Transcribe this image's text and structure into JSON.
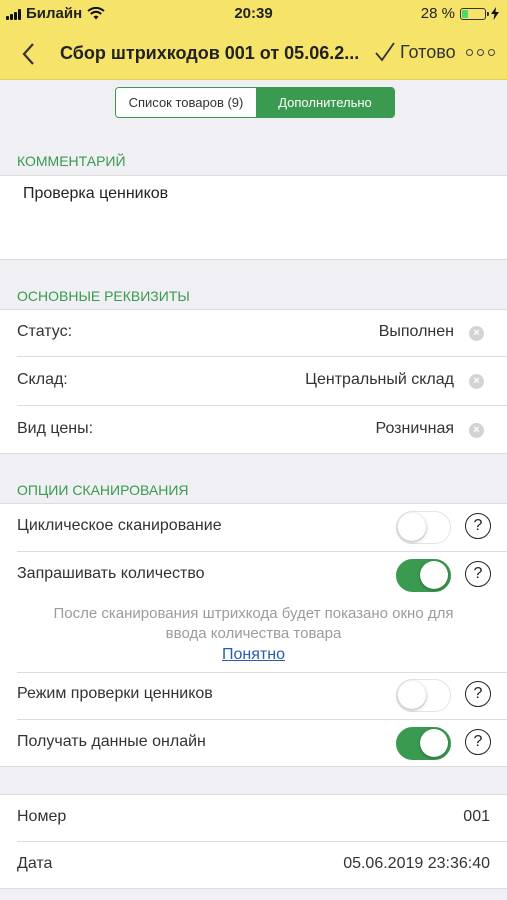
{
  "status_bar": {
    "carrier": "Билайн",
    "time": "20:39",
    "battery": "28 %",
    "battery_level": 0.28
  },
  "nav": {
    "title": "Сбор штрихкодов 001 от 05.06.2...",
    "done_label": "Готово",
    "icons": [
      "back-chevron-icon",
      "checkmark-icon",
      "more-icon"
    ]
  },
  "tabs": [
    {
      "label": "Список товаров (9)",
      "active": false
    },
    {
      "label": "Дополнительно",
      "active": true
    }
  ],
  "comment_section": {
    "header": "КОММЕНТАРИЙ",
    "text": "Проверка ценников"
  },
  "main_section": {
    "header": "ОСНОВНЫЕ РЕКВИЗИТЫ",
    "rows": [
      {
        "label": "Статус:",
        "value": "Выполнен"
      },
      {
        "label": "Склад:",
        "value": "Центральный склад"
      },
      {
        "label": "Вид цены:",
        "value": "Розничная"
      }
    ]
  },
  "scan_section": {
    "header": "ОПЦИИ СКАНИРОВАНИЯ",
    "options": [
      {
        "label": "Циклическое сканирование",
        "on": false
      },
      {
        "label": "Запрашивать количество",
        "on": true
      },
      {
        "label": "Режим проверки ценников",
        "on": false
      },
      {
        "label": "Получать данные онлайн",
        "on": true
      }
    ],
    "hint_line1": "После сканирования штрихкода будет показано окно для",
    "hint_line2": "ввода количества товара",
    "hint_link": "Понятно",
    "help_glyph": "?"
  },
  "info_section": {
    "rows": [
      {
        "label": "Номер",
        "value": "001"
      },
      {
        "label": "Дата",
        "value": "05.06.2019 23:36:40"
      }
    ]
  },
  "colors": {
    "header_yellow": "#f5e36a",
    "accent_green": "#3a9a4f",
    "link_blue": "#2a5bb0",
    "background": "#efeff4"
  }
}
